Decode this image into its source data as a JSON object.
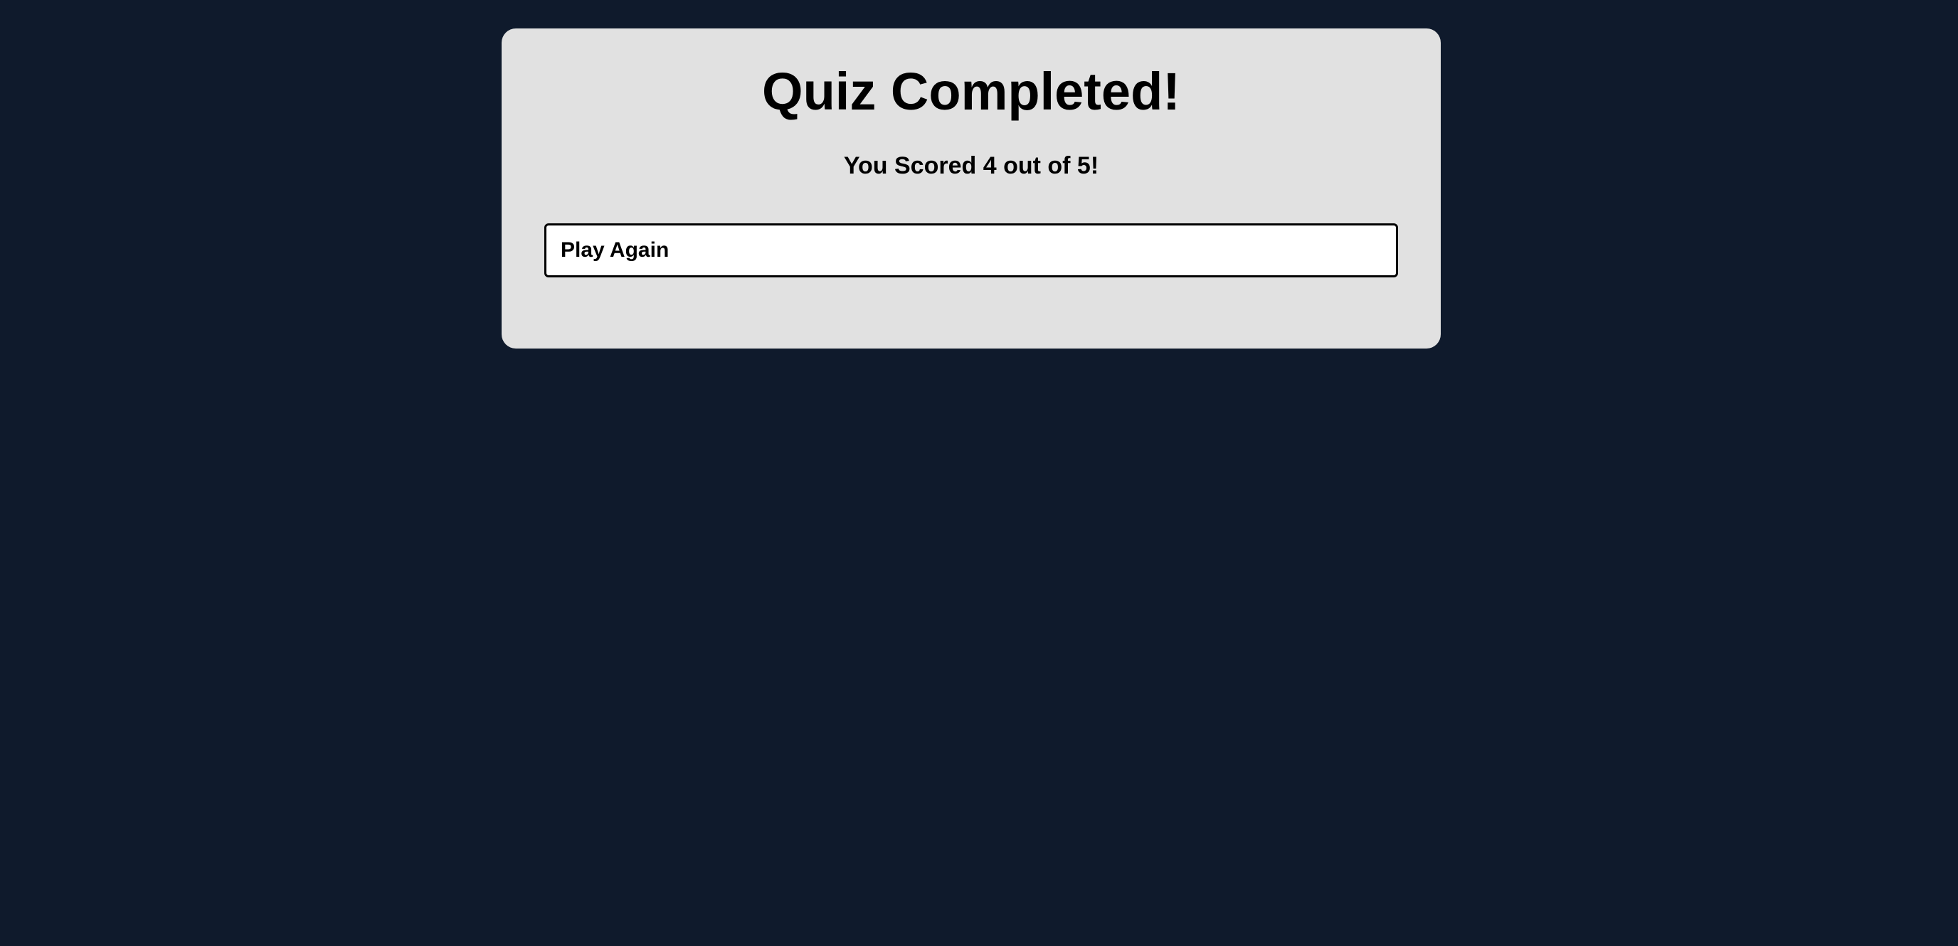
{
  "quiz_result": {
    "title": "Quiz Completed!",
    "score_text": "You Scored 4 out of 5!",
    "score": 4,
    "total": 5,
    "play_again_label": "Play Again"
  },
  "colors": {
    "background": "#0f1a2c",
    "card": "#e1e1e1",
    "button_background": "#ffffff",
    "button_border": "#000000",
    "text": "#000000"
  }
}
